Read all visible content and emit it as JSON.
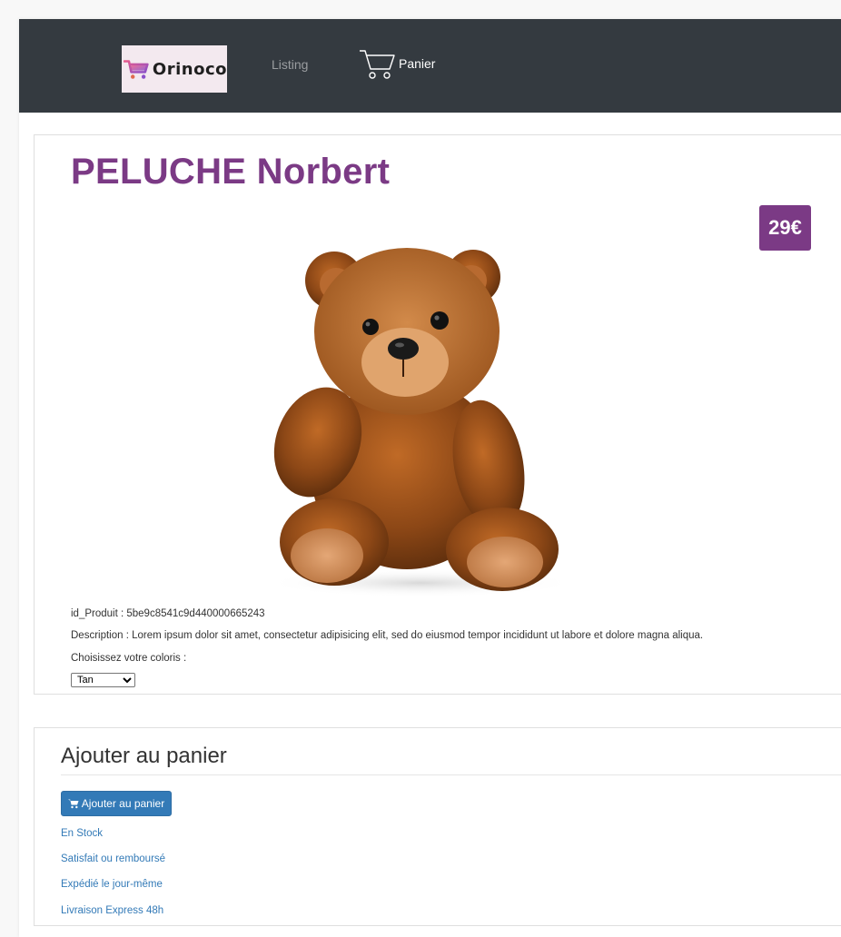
{
  "navbar": {
    "logo_text": "Orinoco",
    "links": {
      "listing": "Listing",
      "cart": "Panier"
    }
  },
  "product": {
    "title": "PELUCHE Norbert",
    "price": "29€",
    "image_icon": "teddy-bear-photo",
    "id_line": "id_Produit : 5be9c8541c9d440000665243",
    "description_line": "Description : Lorem ipsum dolor sit amet, consectetur adipisicing elit, sed do eiusmod tempor incididunt ut labore et dolore magna aliqua.",
    "color_label": "Choisissez votre coloris :",
    "color_selected": "Tan"
  },
  "cart_section": {
    "heading": "Ajouter au panier",
    "add_button_label": "Ajouter au panier",
    "info_links": [
      "En Stock",
      "Satisfait ou remboursé",
      "Expédié le jour-même",
      "Livraison Express 48h"
    ]
  },
  "colors": {
    "navbar_bg": "#343a40",
    "brand_purple": "#7b3a85",
    "button_blue": "#337ab7",
    "link_blue": "#337ab7"
  }
}
